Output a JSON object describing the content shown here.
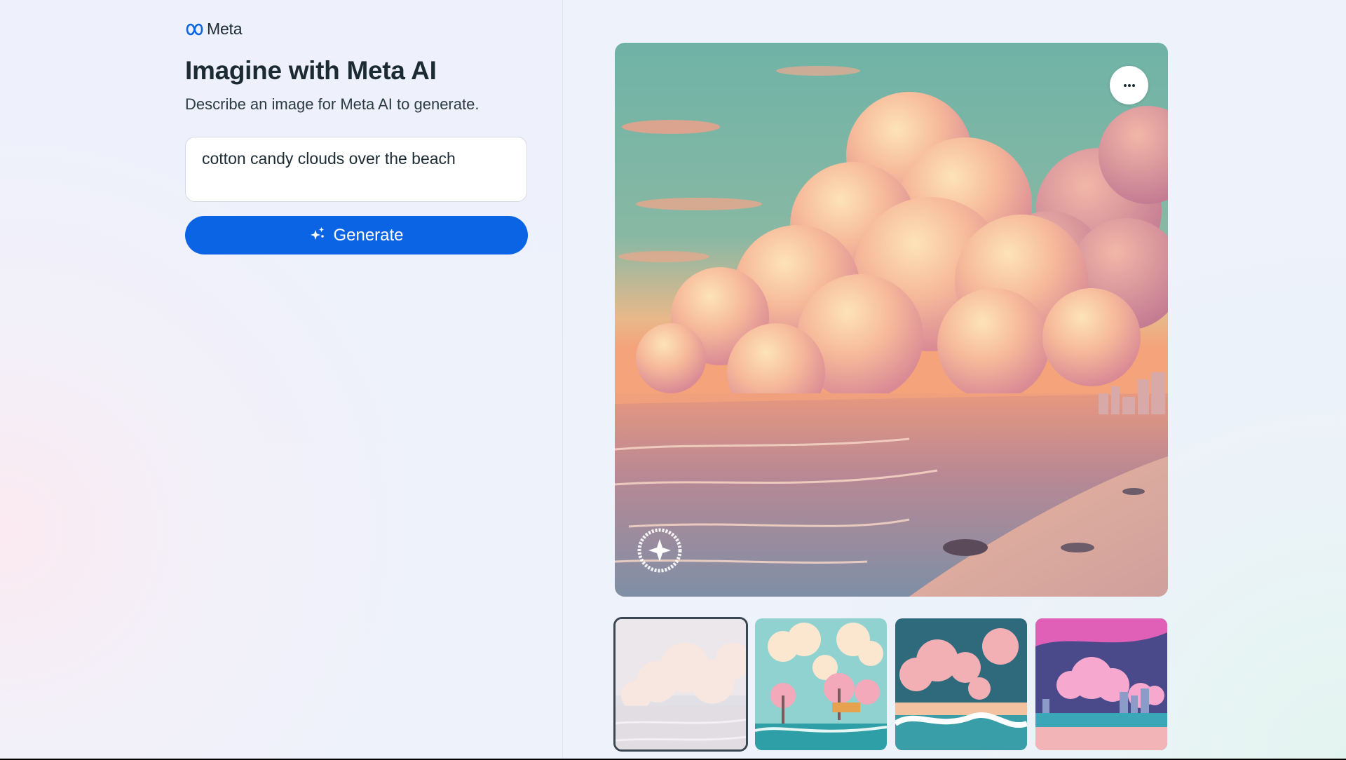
{
  "brand": {
    "logo_icon": "meta-infinity-icon",
    "wordmark": "Meta"
  },
  "header": {
    "title": "Imagine with Meta AI",
    "subtitle": "Describe an image for Meta AI to generate."
  },
  "prompt": {
    "value": "cotton candy clouds over the beach",
    "placeholder": ""
  },
  "generate": {
    "label": "Generate",
    "icon": "sparkle-icon",
    "color": "#0a64e4"
  },
  "main_image": {
    "description_icon": "generated-image",
    "more_icon": "more-horizontal-icon",
    "badge_icon": "imagined-with-ai-badge-icon"
  },
  "thumbnails": [
    {
      "name": "thumbnail-1",
      "selected": true
    },
    {
      "name": "thumbnail-2",
      "selected": false
    },
    {
      "name": "thumbnail-3",
      "selected": false
    },
    {
      "name": "thumbnail-4",
      "selected": false
    }
  ]
}
